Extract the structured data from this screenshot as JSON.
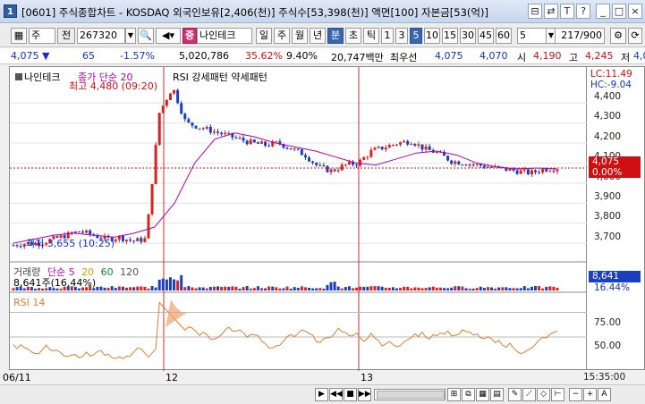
{
  "titlebar": {
    "num": "1",
    "text": "[0601] 주식종합차트 - KOSDAQ 외국인보유[2,406(천)] 주식수[53,398(천)] 액면[100] 자본금[53(억)]",
    "btns": [
      "⊟",
      "⇄",
      "T",
      "?",
      "_",
      "□",
      "×"
    ]
  },
  "toolbar": {
    "period": "주",
    "mode": "전",
    "code": "267320",
    "name": "나인테크",
    "intervals": [
      "일",
      "주",
      "월",
      "년",
      "분",
      "초",
      "틱"
    ],
    "active_interval": "분",
    "minutes": [
      "1",
      "3",
      "5",
      "10",
      "15",
      "30",
      "45",
      "60"
    ],
    "active_minute": "5",
    "count": "5",
    "range": "217/900"
  },
  "pricebar": {
    "price": "4,075",
    "change": "65",
    "change_pct": "-1.57%",
    "volume": "5,020,786",
    "vol_ratio": "35.62%",
    "turnover": "9.40%",
    "amount": "20,747백만",
    "best_label": "최우선",
    "ask": "4,075",
    "bid": "4,070",
    "open_label": "시",
    "open": "4,190",
    "high_label": "고",
    "high": "4,245",
    "low_label": "저",
    "low": "4,0"
  },
  "legend": {
    "name": "나인테크",
    "ma": "종가 단순 20",
    "indicators": "RSI 강세패턴  약세패턴",
    "max_label": "최고 4,480 (09:20)",
    "min_label": "최저 3,655 (10:25)",
    "vol_title": "거래량",
    "vol_ma": "단순 5",
    "vol_ma2": "20",
    "vol_ma3": "60",
    "vol_ma4": "120",
    "vol_value": "8,641주(16.44%)",
    "rsi_title": "RSI 14"
  },
  "axis": {
    "lc": "LC:11.49",
    "hc": "HC:-9.04",
    "price_ticks": [
      "4,400",
      "4,300",
      "4,200",
      "4,100",
      "4,000",
      "3,900",
      "3,800",
      "3,700"
    ],
    "current_price": "4,075",
    "current_pct": "0.00%",
    "vol_badge": "8,641",
    "vol_pct": "16.44%",
    "rsi_ticks": [
      "75.00",
      "50.00"
    ],
    "time": "15:35:00"
  },
  "xlabels": [
    "06/11",
    "12",
    "13"
  ],
  "colors": {
    "up": "#e02020",
    "down": "#1a3fc0",
    "ma": "#b000b0",
    "rsi": "#d88030",
    "accent": "#3a66b0"
  },
  "chart_data": [
    {
      "type": "candlestick",
      "title": "",
      "x_labels": [
        "06/11",
        "12",
        "13"
      ],
      "ylim": [
        3620,
        4490
      ],
      "series": [
        {
          "name": "종가 단순 20",
          "values": [
            3700,
            3720,
            3740,
            3750,
            3740,
            3730,
            3750,
            3780,
            3900,
            4100,
            4220,
            4250,
            4230,
            4200,
            4180,
            4160,
            4130,
            4100,
            4090,
            4120,
            4150,
            4160,
            4140,
            4100,
            4080,
            4070,
            4075,
            4070
          ]
        }
      ],
      "price_path": [
        3690,
        3700,
        3700,
        3720,
        3740,
        3760,
        3740,
        3720,
        3730,
        3710,
        3720,
        4350,
        4480,
        4300,
        4280,
        4260,
        4240,
        4220,
        4200,
        4190,
        4200,
        4170,
        4140,
        4080,
        4060,
        4090,
        4100,
        4160,
        4180,
        4200,
        4210,
        4170,
        4150,
        4110,
        4100,
        4090,
        4080,
        4070,
        4060,
        4050,
        4070,
        4075
      ]
    },
    {
      "type": "bar",
      "title": "거래량"
    },
    {
      "type": "line",
      "title": "RSI 14",
      "ylim": [
        20,
        90
      ]
    }
  ],
  "bottombar": {
    "buttons": [
      "▶",
      "◀◀",
      "■",
      "▶▶",
      "|"
    ]
  }
}
